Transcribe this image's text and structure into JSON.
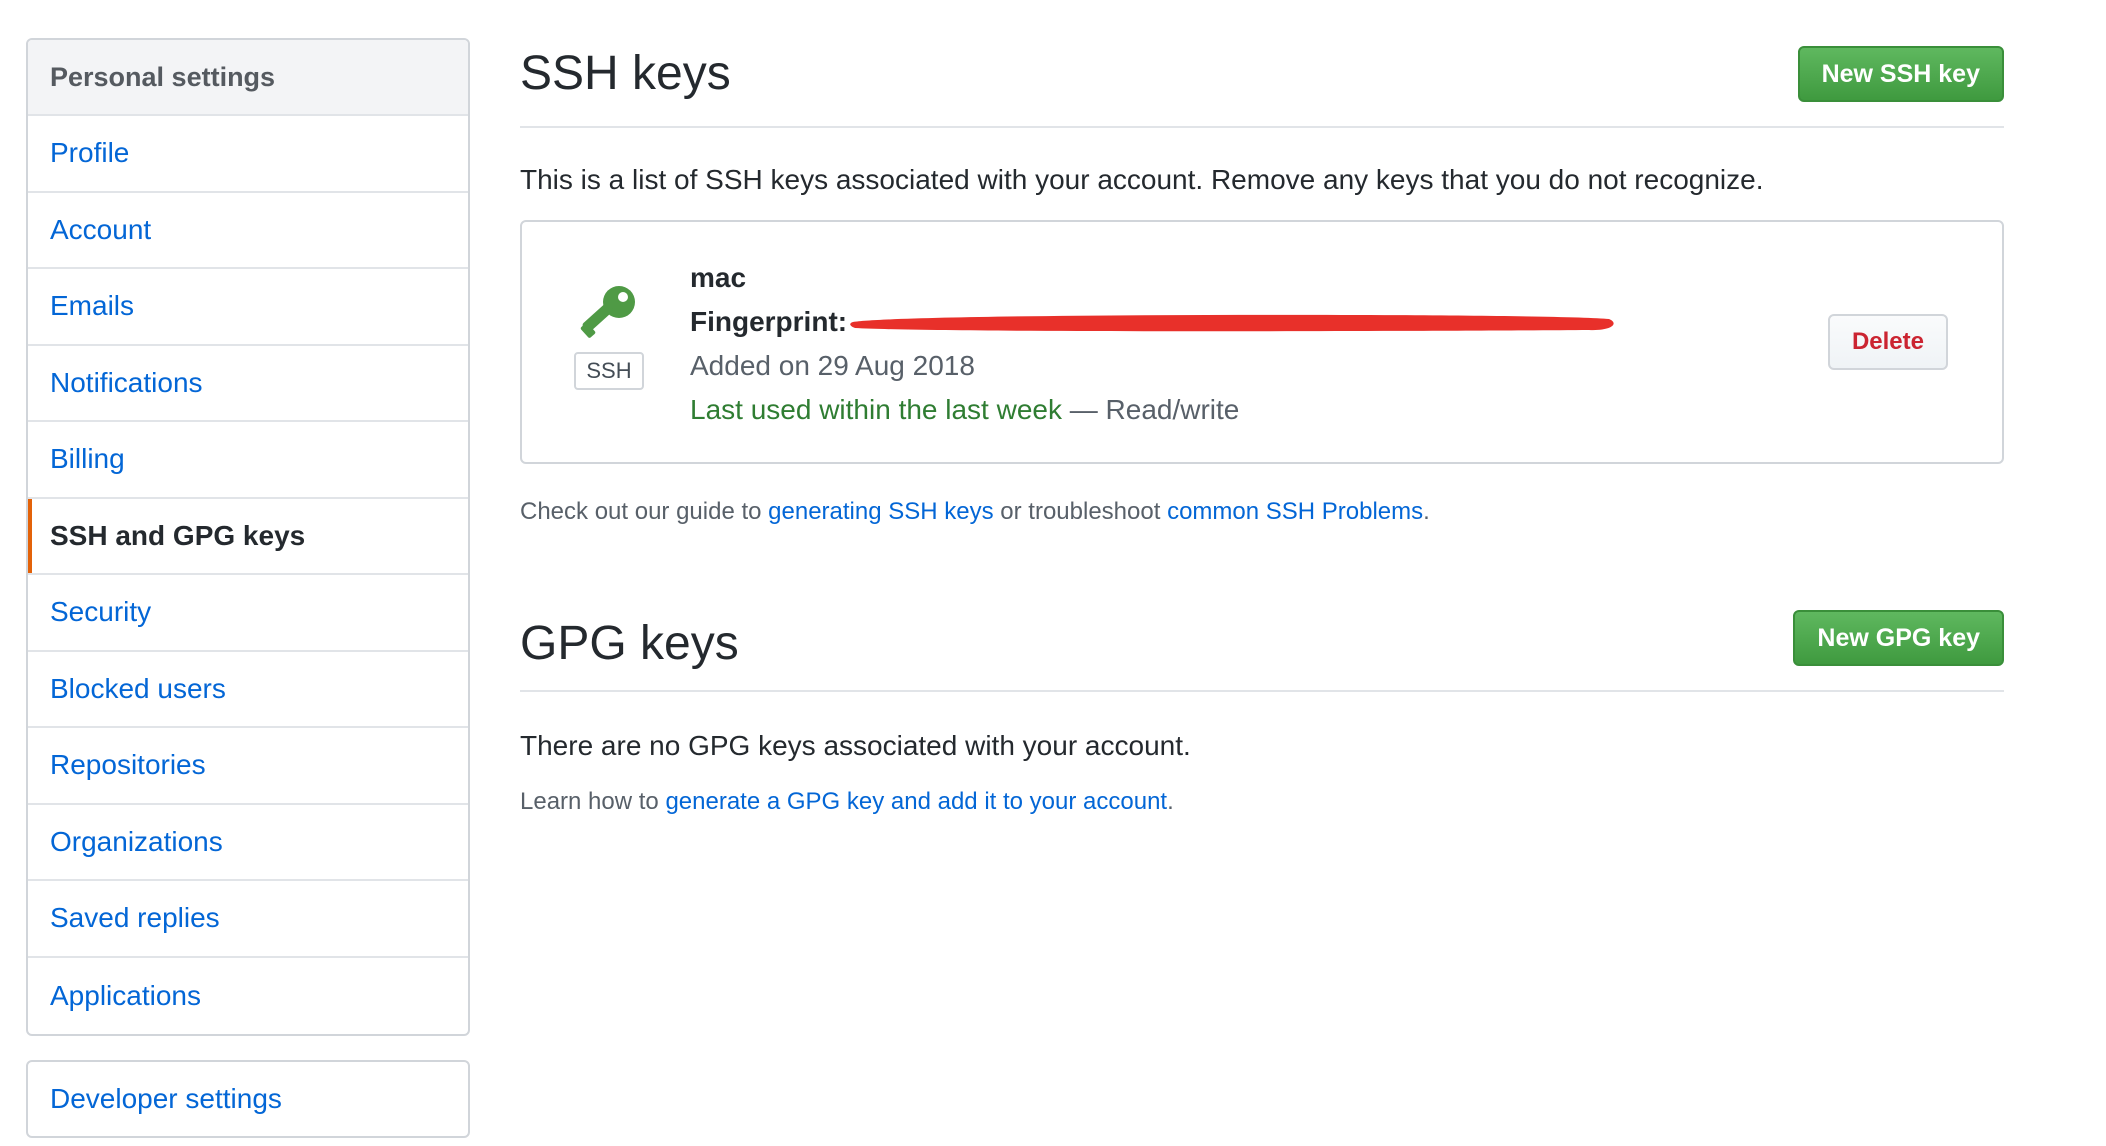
{
  "sidebar": {
    "heading": "Personal settings",
    "items": [
      {
        "label": "Profile"
      },
      {
        "label": "Account"
      },
      {
        "label": "Emails"
      },
      {
        "label": "Notifications"
      },
      {
        "label": "Billing"
      },
      {
        "label": "SSH and GPG keys",
        "selected": true
      },
      {
        "label": "Security"
      },
      {
        "label": "Blocked users"
      },
      {
        "label": "Repositories"
      },
      {
        "label": "Organizations"
      },
      {
        "label": "Saved replies"
      },
      {
        "label": "Applications"
      }
    ],
    "developer": {
      "label": "Developer settings"
    }
  },
  "ssh": {
    "title": "SSH keys",
    "new_button": "New SSH key",
    "intro": "This is a list of SSH keys associated with your account. Remove any keys that you do not recognize.",
    "key": {
      "name": "mac",
      "fingerprint_label": "Fingerprint:",
      "badge": "SSH",
      "added": "Added on 29 Aug 2018",
      "last_used": "Last used within the last week",
      "access": " — Read/write",
      "delete": "Delete",
      "icon": "key-icon",
      "redaction_color": "#e8302a"
    },
    "help": {
      "prefix": "Check out our guide to ",
      "link1": "generating SSH keys",
      "middle": " or troubleshoot ",
      "link2": "common SSH Problems",
      "suffix": "."
    }
  },
  "gpg": {
    "title": "GPG keys",
    "new_button": "New GPG key",
    "empty": "There are no GPG keys associated with your account.",
    "learn": {
      "prefix": "Learn how to ",
      "link": "generate a GPG key and add it to your account",
      "suffix": "."
    }
  },
  "colors": {
    "link": "#0366d6",
    "primary": "#3f9a3f",
    "danger": "#cb2431",
    "selected_accent": "#e36209"
  }
}
